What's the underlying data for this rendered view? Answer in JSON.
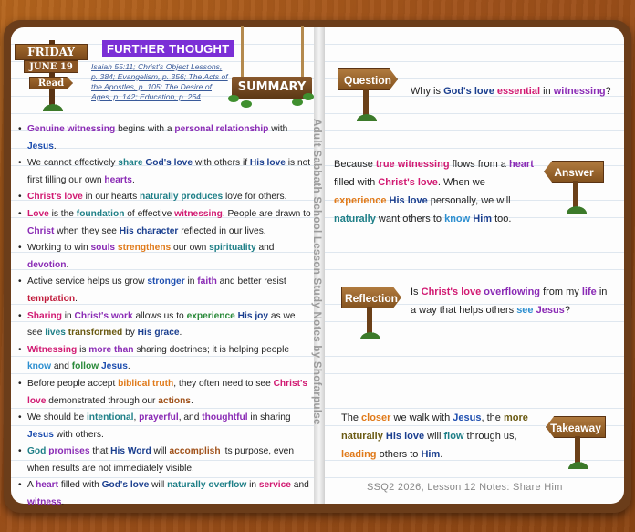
{
  "header": {
    "day": "FRIDAY",
    "date": "JUNE 19",
    "read_label": "Read",
    "further_thought": "FURTHER THOUGHT",
    "references": "Isaiah 55:11; Christ's Object Lessons, p. 384; Evangelism, p. 356; The Acts of the Apostles, p. 105; The Desire of Ages, p. 142; Education, p. 264",
    "summary": "SUMMARY"
  },
  "spine_text": "Adult Sabbath School Lesson Study Notes by Shofarpulse",
  "bullets": [
    [
      [
        "Genuine witnessing",
        "purple"
      ],
      [
        " begins with a ",
        ""
      ],
      [
        "personal relationship",
        "purple"
      ],
      [
        " with ",
        ""
      ],
      [
        "Jesus",
        "blue"
      ],
      [
        ".",
        ""
      ]
    ],
    [
      [
        "We cannot effectively ",
        ""
      ],
      [
        "share",
        "teal"
      ],
      [
        " ",
        ""
      ],
      [
        "God's love",
        "darkblue"
      ],
      [
        " with others if ",
        ""
      ],
      [
        "His love",
        "darkblue"
      ],
      [
        " is not first filling our own ",
        ""
      ],
      [
        "hearts",
        "purple"
      ],
      [
        ".",
        ""
      ]
    ],
    [
      [
        "Christ's love",
        "pink"
      ],
      [
        " in our hearts ",
        ""
      ],
      [
        "naturally produces",
        "teal"
      ],
      [
        " love for others.",
        ""
      ]
    ],
    [
      [
        "Love",
        "pink"
      ],
      [
        " is the ",
        ""
      ],
      [
        "foundation",
        "teal"
      ],
      [
        " of effective ",
        ""
      ],
      [
        "witnessing",
        "pink"
      ],
      [
        ". People are drawn to ",
        ""
      ],
      [
        "Christ",
        "purple"
      ],
      [
        " when they see ",
        ""
      ],
      [
        "His character",
        "darkblue"
      ],
      [
        " reflected in our lives.",
        ""
      ]
    ],
    [
      [
        "Working to win ",
        ""
      ],
      [
        "souls",
        "purple"
      ],
      [
        " ",
        ""
      ],
      [
        "strengthens",
        "orange"
      ],
      [
        " our own ",
        ""
      ],
      [
        "spirituality",
        "teal"
      ],
      [
        " and ",
        ""
      ],
      [
        "devotion",
        "purple"
      ],
      [
        ".",
        ""
      ]
    ],
    [
      [
        "Active service helps us grow ",
        ""
      ],
      [
        "stronger",
        "blue"
      ],
      [
        " in ",
        ""
      ],
      [
        "faith",
        "purple"
      ],
      [
        " and better resist ",
        ""
      ],
      [
        "temptation",
        "red"
      ],
      [
        ".",
        ""
      ]
    ],
    [
      [
        "Sharing",
        "pink"
      ],
      [
        " in ",
        ""
      ],
      [
        "Christ's work",
        "purple"
      ],
      [
        " allows us to ",
        ""
      ],
      [
        "experience",
        "green"
      ],
      [
        " ",
        ""
      ],
      [
        "His joy",
        "darkblue"
      ],
      [
        " as we see ",
        ""
      ],
      [
        "lives",
        "teal"
      ],
      [
        " ",
        ""
      ],
      [
        "transformed",
        "olive"
      ],
      [
        " by ",
        ""
      ],
      [
        "His grace",
        "darkblue"
      ],
      [
        ".",
        ""
      ]
    ],
    [
      [
        "Witnessing",
        "pink"
      ],
      [
        " is ",
        ""
      ],
      [
        "more than",
        "purple"
      ],
      [
        " sharing doctrines; it is helping people ",
        ""
      ],
      [
        "know",
        "lightblue"
      ],
      [
        " and ",
        ""
      ],
      [
        "follow",
        "green"
      ],
      [
        " ",
        ""
      ],
      [
        "Jesus",
        "blue"
      ],
      [
        ".",
        ""
      ]
    ],
    [
      [
        "Before people accept ",
        ""
      ],
      [
        "biblical truth",
        "orange"
      ],
      [
        ", they often need to see ",
        ""
      ],
      [
        "Christ's love",
        "pink"
      ],
      [
        " demonstrated through our ",
        ""
      ],
      [
        "actions",
        "brown"
      ],
      [
        ".",
        ""
      ]
    ],
    [
      [
        "We should be ",
        ""
      ],
      [
        "intentional",
        "teal"
      ],
      [
        ", ",
        ""
      ],
      [
        "prayerful",
        "purple"
      ],
      [
        ", and ",
        ""
      ],
      [
        "thoughtful",
        "purple"
      ],
      [
        " in sharing ",
        ""
      ],
      [
        "Jesus",
        "blue"
      ],
      [
        " with others.",
        ""
      ]
    ],
    [
      [
        "God",
        "teal"
      ],
      [
        " ",
        ""
      ],
      [
        "promises",
        "purple"
      ],
      [
        " that ",
        ""
      ],
      [
        "His Word",
        "darkblue"
      ],
      [
        " will ",
        ""
      ],
      [
        "accomplish",
        "brown"
      ],
      [
        " its purpose, even when results are not immediately visible.",
        ""
      ]
    ],
    [
      [
        "A ",
        ""
      ],
      [
        "heart",
        "purple"
      ],
      [
        " filled with ",
        ""
      ],
      [
        "God's love",
        "darkblue"
      ],
      [
        " will ",
        ""
      ],
      [
        "naturally overflow",
        "teal"
      ],
      [
        " in ",
        ""
      ],
      [
        "service",
        "pink"
      ],
      [
        " and ",
        ""
      ],
      [
        "witness",
        "purple"
      ],
      [
        ".",
        ""
      ]
    ]
  ],
  "qa": {
    "question_label": "Question",
    "question": [
      [
        "Why is ",
        ""
      ],
      [
        "God's love",
        "darkblue"
      ],
      [
        " ",
        ""
      ],
      [
        "essential",
        "pink"
      ],
      [
        " in ",
        ""
      ],
      [
        "witnessing",
        "purple"
      ],
      [
        "?",
        ""
      ]
    ],
    "answer_label": "Answer",
    "answer": [
      [
        "Because ",
        ""
      ],
      [
        "true witnessing",
        "pink"
      ],
      [
        " flows from a ",
        ""
      ],
      [
        "heart",
        "purple"
      ],
      [
        " filled with ",
        ""
      ],
      [
        "Christ's love",
        "pink"
      ],
      [
        ". When we ",
        ""
      ],
      [
        "experience",
        "orange"
      ],
      [
        " ",
        ""
      ],
      [
        "His love",
        "darkblue"
      ],
      [
        " personally, we will ",
        ""
      ],
      [
        "naturally",
        "teal"
      ],
      [
        " want others to ",
        ""
      ],
      [
        "know",
        "lightblue"
      ],
      [
        " ",
        ""
      ],
      [
        "Him",
        "darkblue"
      ],
      [
        " too.",
        ""
      ]
    ],
    "reflection_label": "Reflection",
    "reflection": [
      [
        "Is ",
        ""
      ],
      [
        "Christ's love",
        "pink"
      ],
      [
        " ",
        ""
      ],
      [
        "overflowing",
        "purple"
      ],
      [
        " from my ",
        ""
      ],
      [
        "life",
        "purple"
      ],
      [
        " in a way that helps others ",
        ""
      ],
      [
        "see",
        "lightblue"
      ],
      [
        " ",
        ""
      ],
      [
        "Jesus",
        "purple"
      ],
      [
        "?",
        ""
      ]
    ],
    "takeaway_label": "Takeaway",
    "takeaway": [
      [
        "The ",
        ""
      ],
      [
        "closer",
        "orange"
      ],
      [
        " we walk with ",
        ""
      ],
      [
        "Jesus",
        "blue"
      ],
      [
        ", the ",
        ""
      ],
      [
        "more naturally",
        "olive"
      ],
      [
        " ",
        ""
      ],
      [
        "His love",
        "darkblue"
      ],
      [
        " will ",
        ""
      ],
      [
        "flow",
        "teal"
      ],
      [
        " through us, ",
        ""
      ],
      [
        "leading",
        "orange"
      ],
      [
        " others to ",
        ""
      ],
      [
        "Him",
        "darkblue"
      ],
      [
        ".",
        ""
      ]
    ]
  },
  "footer": "SSQ2 2026, Lesson 12 Notes: Share Him"
}
